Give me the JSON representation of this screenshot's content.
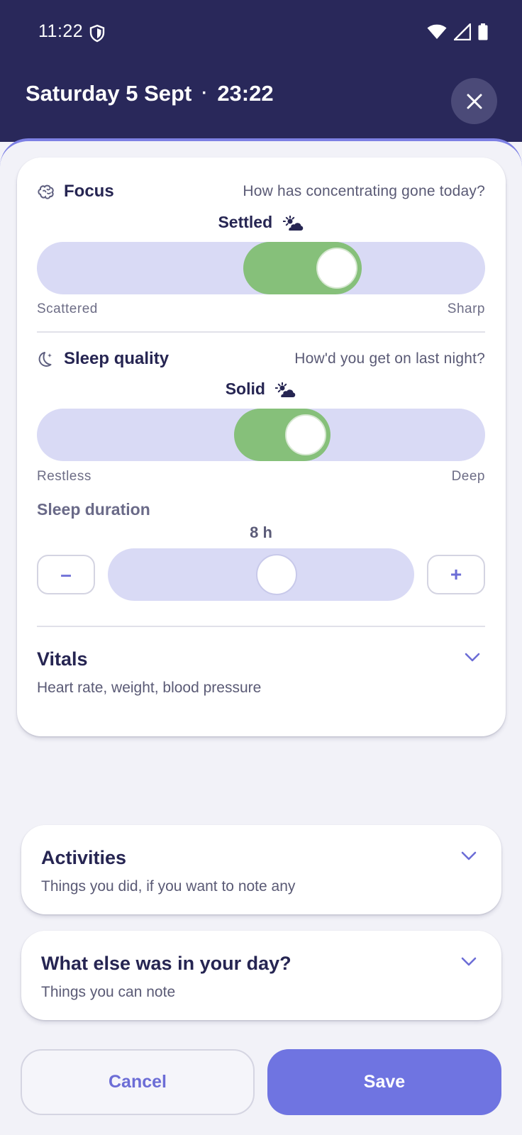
{
  "status_bar": {
    "time": "11:22"
  },
  "header": {
    "date": "Saturday 5 Sept",
    "separator": "·",
    "time": "23:22"
  },
  "focus": {
    "title": "Focus",
    "question": "How has concentrating gone today?",
    "value_label": "Settled",
    "min_label": "Scattered",
    "max_label": "Sharp",
    "level": 0.67,
    "fill_color": "#86c07a"
  },
  "sleep_quality": {
    "title": "Sleep quality",
    "question": "How'd you get on last night?",
    "value_label": "Solid",
    "min_label": "Restless",
    "max_label": "Deep",
    "level": 0.6,
    "fill_color": "#86c07a"
  },
  "sleep_duration": {
    "title": "Sleep duration",
    "value": "8 h",
    "level": 0.55,
    "minus_label": "–",
    "plus_label": "+"
  },
  "vitals": {
    "title": "Vitals",
    "subtitle": "Heart rate, weight, blood pressure"
  },
  "activities": {
    "title": "Activities",
    "subtitle": "Things you did, if you want to note any"
  },
  "else_in_day": {
    "title": "What else was in your day?",
    "subtitle": "Things you can note"
  },
  "actions": {
    "cancel_label": "Cancel",
    "save_label": "Save"
  },
  "colors": {
    "header_bg": "#29285a",
    "accent": "#6f74e1",
    "track": "#d9daf5"
  },
  "icons": [
    "shield-icon",
    "wifi-icon",
    "signal-icon",
    "battery-icon",
    "close-icon",
    "brain-icon",
    "moon-icon",
    "sun-cloud-icon",
    "chevron-down-icon"
  ]
}
